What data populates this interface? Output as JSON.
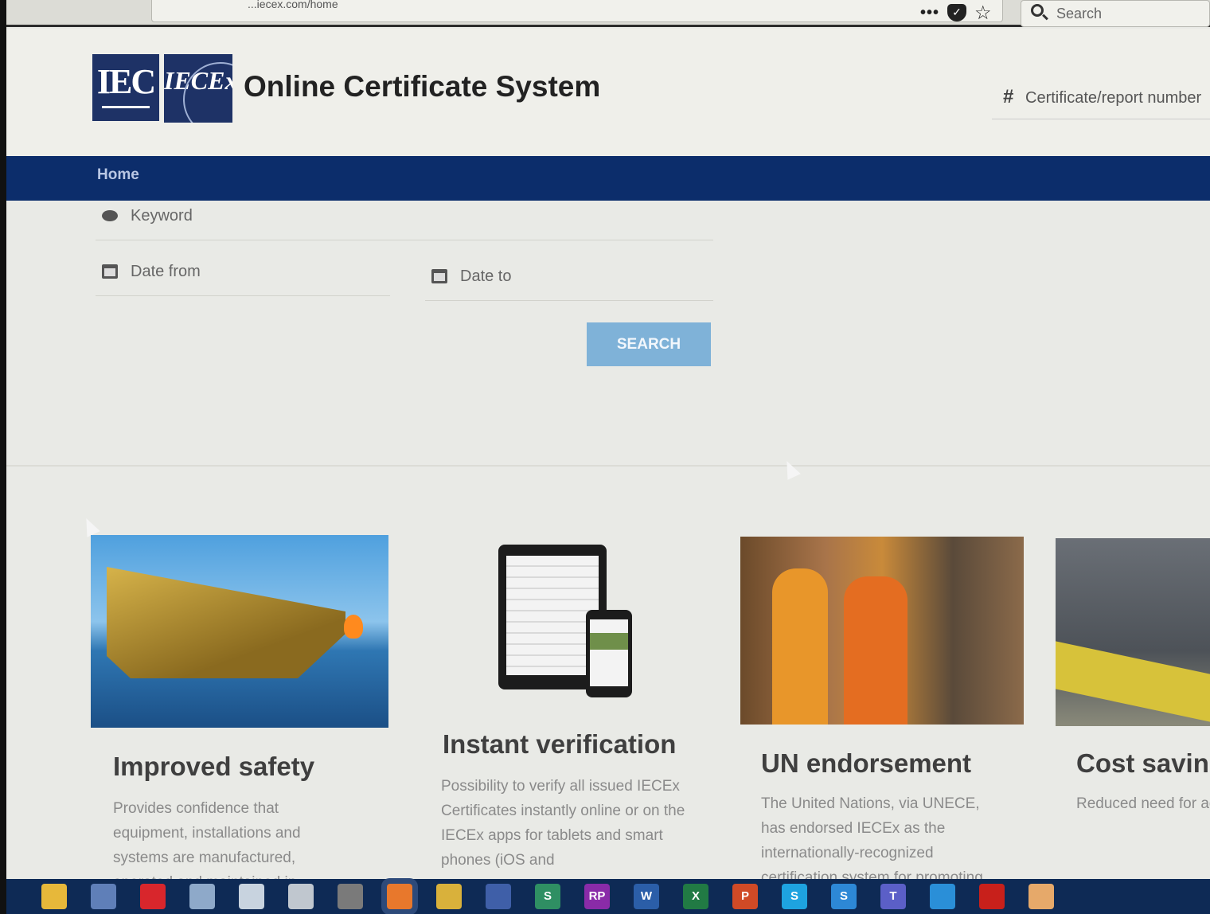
{
  "browser": {
    "url_fragment": "...iecex.com/home",
    "menu_label": "•••",
    "search_placeholder": "Search"
  },
  "header": {
    "logo_iec": "IEC",
    "logo_iecex": "IECEx",
    "title": "Online Certificate System",
    "cert_search_placeholder": "Certificate/report number"
  },
  "nav": {
    "home_label": "Home"
  },
  "search_form": {
    "keyword_placeholder": "Keyword",
    "date_from_placeholder": "Date from",
    "date_to_placeholder": "Date to",
    "search_button": "SEARCH"
  },
  "features": [
    {
      "title": "Improved safety",
      "text": "Provides confidence that equipment, installations and systems are manufactured, operated and maintained in"
    },
    {
      "title": "Instant verification",
      "text": "Possibility to verify all issued IECEx Certificates instantly online or on the IECEx apps for tablets and smart phones (iOS and"
    },
    {
      "title": "UN endorsement",
      "text": "The United Nations, via UNECE, has endorsed IECEx as the internationally-recognized certification system for promoting"
    },
    {
      "title": "Cost saving",
      "text": "Reduced need for ad testing and certifica in faster access to m"
    }
  ],
  "taskbar": {
    "apps": [
      {
        "name": "file-explorer",
        "color": "#e7b83a",
        "glyph": ""
      },
      {
        "name": "pen-tool",
        "color": "#5f7fb8",
        "glyph": ""
      },
      {
        "name": "fortinet",
        "color": "#d8262c",
        "glyph": ""
      },
      {
        "name": "paint",
        "color": "#8ea9c9",
        "glyph": ""
      },
      {
        "name": "snipping",
        "color": "#c8d3df",
        "glyph": ""
      },
      {
        "name": "paint-brush",
        "color": "#c0c7cf",
        "glyph": ""
      },
      {
        "name": "calculator",
        "color": "#7a7a7a",
        "glyph": ""
      },
      {
        "name": "firefox",
        "color": "#e8782c",
        "glyph": ""
      },
      {
        "name": "chrome",
        "color": "#d9b13b",
        "glyph": ""
      },
      {
        "name": "keepass",
        "color": "#3f5fa8",
        "glyph": ""
      },
      {
        "name": "sway",
        "color": "#2f8f63",
        "glyph": "S"
      },
      {
        "name": "onenote",
        "color": "#8a2ba8",
        "glyph": "RP"
      },
      {
        "name": "word",
        "color": "#2b5ea8",
        "glyph": "W"
      },
      {
        "name": "excel",
        "color": "#217a44",
        "glyph": "X"
      },
      {
        "name": "powerpoint",
        "color": "#d04a26",
        "glyph": "P"
      },
      {
        "name": "skype",
        "color": "#1ea3e0",
        "glyph": "S"
      },
      {
        "name": "skype-business",
        "color": "#2d88d6",
        "glyph": "S"
      },
      {
        "name": "teams",
        "color": "#5b5fc7",
        "glyph": "T"
      },
      {
        "name": "vscode",
        "color": "#2a8fd8",
        "glyph": ""
      },
      {
        "name": "acrobat",
        "color": "#c8201b",
        "glyph": ""
      },
      {
        "name": "settings-app",
        "color": "#e6a96a",
        "glyph": ""
      }
    ]
  }
}
